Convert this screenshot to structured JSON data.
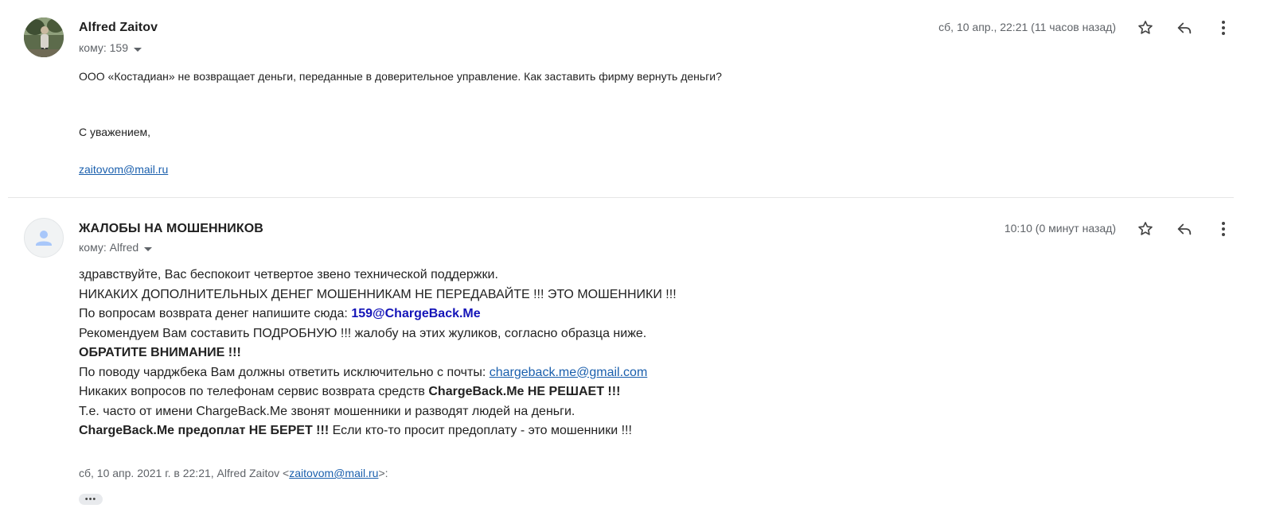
{
  "messages": [
    {
      "sender": "Alfred Zaitov",
      "to": "кому: 159",
      "date": "сб, 10 апр., 22:21 (11 часов назад)",
      "avatar": "photo",
      "body": {
        "line1": "ООО «Костадиан» не возвращает деньги, переданные в доверительное управление. Как заставить фирму вернуть деньги?",
        "regards": "С уважением,",
        "email": "zaitovom@mail.ru"
      }
    },
    {
      "sender": "ЖАЛОБЫ НА МОШЕННИКОВ",
      "to": "кому: Alfred",
      "date": "10:10 (0 минут назад)",
      "avatar": "placeholder-person",
      "body": {
        "l1": "здравствуйте, Вас беспокоит четвертое звено технической поддержки.",
        "l2": "НИКАКИХ ДОПОЛНИТЕЛЬНЫХ ДЕНЕГ МОШЕННИКАМ НЕ ПЕРЕДАВАЙТЕ !!! ЭТО МОШЕННИКИ !!!",
        "l3_prefix": "По вопросам возврата денег напишите сюда: ",
        "l3_email": "159@ChargeBack.Me",
        "l4": "Рекомендуем Вам составить ПОДРОБНУЮ !!! жалобу на этих жуликов, согласно образца ниже.",
        "l5": "ОБРАТИТЕ ВНИМАНИЕ !!!",
        "l6_prefix": "По поводу чарджбека Вам должны ответить исключительно с почты: ",
        "l6_email": "chargeback.me@gmail.com",
        "l7_prefix": "Никаких вопросов по телефонам сервис возврата средств ",
        "l7_bold": "ChargeBack.Me НЕ РЕШАЕТ !!!",
        "l8": "Т.е. часто от имени ChargeBack.Me звонят мошенники и разводят людей на деньги.",
        "l9_bold": "ChargeBack.Me предоплат НЕ БЕРЕТ !!!",
        "l9_suffix": " Если кто-то просит предоплату - это мошенники !!!"
      },
      "quote": {
        "prefix": "сб, 10 апр. 2021 г. в 22:21, Alfred Zaitov <",
        "email": "zaitovom@mail.ru",
        "suffix": ">:"
      },
      "trimmed_label": "•••"
    }
  ],
  "icons": {
    "star": "star-outline-icon",
    "reply": "reply-icon",
    "more": "more-vert-icon",
    "caret": "caret-down-icon",
    "person": "person-icon"
  },
  "colors": {
    "link": "#1a5fad",
    "email_highlight": "#1414b8",
    "meta_gray": "#5f6368"
  }
}
